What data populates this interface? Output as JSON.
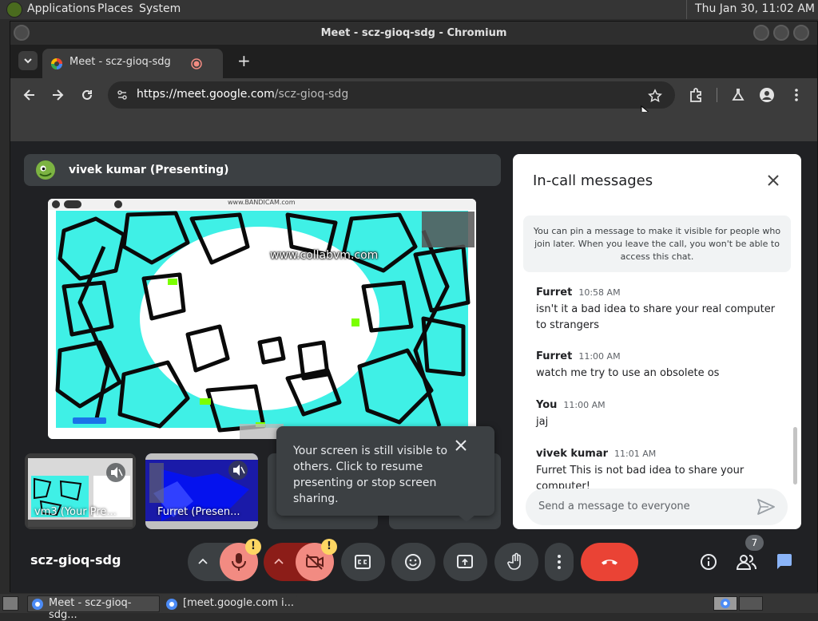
{
  "top_panel": {
    "menus": [
      "Applications",
      "Places",
      "System"
    ],
    "clock": "Thu Jan 30, 11:02 AM"
  },
  "window": {
    "title": "Meet - scz-gioq-sdg - Chromium"
  },
  "tab": {
    "title": "Meet - scz-gioq-sdg",
    "new_tab_symbol": "+"
  },
  "omnibox": {
    "url_host": "https://meet.google.com",
    "url_path": "/scz-gioq-sdg"
  },
  "presenter": {
    "name": "vivek kumar (Presenting)"
  },
  "stage": {
    "watermark": "www.collabvm.com",
    "top_text": "www.BANDICAM.com"
  },
  "thumbnails": [
    {
      "label": "vm3 (Your Pre..."
    },
    {
      "label": "Furret (Presen..."
    }
  ],
  "tooltip": {
    "text": "Your screen is still visible to others. Click to resume presenting or stop screen sharing."
  },
  "chat": {
    "title": "In-call messages",
    "notice": "You can pin a message to make it visible for people who join later. When you leave the call, you won't be able to access this chat.",
    "messages": [
      {
        "sender": "Furret",
        "time": "10:58 AM",
        "text": "isn't it a bad idea to share your real computer to strangers"
      },
      {
        "sender": "Furret",
        "time": "11:00 AM",
        "text": "watch me try to use an obsolete os"
      },
      {
        "sender": "You",
        "time": "11:00 AM",
        "text": "jaj"
      },
      {
        "sender": "vivek kumar",
        "time": "11:01 AM",
        "text": "Furret This is not bad idea to share your computer!"
      }
    ],
    "input_placeholder": "Send a message to everyone"
  },
  "meeting": {
    "code": "scz-gioq-sdg",
    "people_count": "7",
    "warning_symbol": "!"
  },
  "taskbar": {
    "items": [
      "Meet - scz-gioq-sdg...",
      "[meet.google.com i..."
    ]
  },
  "colors": {
    "meet_bg": "#202124",
    "end_call": "#ea4335",
    "muted_red": "#f28b82",
    "chat_blue": "#8ab4f8",
    "badge_yellow": "#fdd663",
    "tiles_cyan": "#3ff0e6"
  }
}
